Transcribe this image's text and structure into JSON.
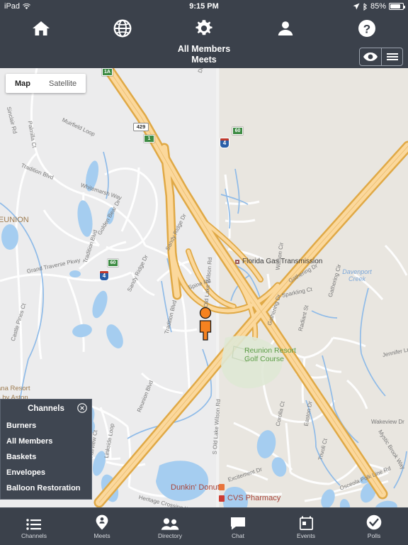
{
  "status_bar": {
    "device": "iPad",
    "wifi_icon": "wifi-icon",
    "time": "9:15 PM",
    "location_icon": "location-arrow-icon",
    "bluetooth_icon": "bluetooth-icon",
    "battery_text": "85%",
    "battery_level": 85
  },
  "header": {
    "icons": [
      {
        "name": "home-icon",
        "label": "Home"
      },
      {
        "name": "globe-icon",
        "label": "Globe"
      },
      {
        "name": "gear-icon",
        "label": "Settings"
      },
      {
        "name": "person-icon",
        "label": "Profile"
      },
      {
        "name": "help-icon",
        "label": "Help"
      }
    ],
    "title_line1": "All Members",
    "title_line2": "Meets",
    "right_buttons": [
      {
        "name": "eye-icon",
        "label": "Visibility"
      },
      {
        "name": "hamburger-icon",
        "label": "Menu"
      }
    ]
  },
  "map": {
    "type_toggle": {
      "options": [
        "Map",
        "Satellite"
      ],
      "selected": "Map"
    },
    "accent_orange": "#f58220",
    "background_left": "#ececed",
    "background_right": "#e9e6e0",
    "highway_color": "#f6c77a",
    "water_color": "#a5cdf0",
    "shields": [
      {
        "text": "1A",
        "style": "green"
      },
      {
        "text": "429",
        "style": "us"
      },
      {
        "text": "1",
        "style": "green"
      },
      {
        "text": "4",
        "style": "interstate"
      },
      {
        "text": "60",
        "style": "green"
      },
      {
        "text": "60",
        "style": "green"
      },
      {
        "text": "4",
        "style": "interstate"
      }
    ],
    "pois": [
      {
        "label": "Florida Gas Transmission",
        "kind": "industrial"
      },
      {
        "label": "Reunion Resort\nGolf Course",
        "kind": "golf"
      },
      {
        "label": "Dunkin' Donuts",
        "kind": "restaurant"
      },
      {
        "label": "CVS Pharmacy",
        "kind": "pharmacy"
      }
    ],
    "water_labels": [
      "Davenport",
      "Creek"
    ],
    "area_labels": [
      "REUNION",
      "ana Resort",
      "do by Aston"
    ],
    "road_labels": [
      "Sinclair Rd",
      "Palmilla Ct",
      "Muirfield Loop",
      "Tradition Blvd",
      "Whitemarsh Way",
      "Grand Traverse Pkwy",
      "Castle Pines Ct",
      "Golden Bear Dr",
      "Sandy Ridge Dr",
      "Sandy Ridge Dr",
      "Spine Rd",
      "Watson Cir",
      "Gathering Dr",
      "Sparkling Ct",
      "Gathering Dr",
      "Gathering Cir",
      "Radiant St",
      "Jennifer Ln",
      "Wakeview Dr",
      "Mystic Brook Way",
      "Corolla Ct",
      "Easton Dr",
      "Excitement Dr",
      "Trivoli Ct",
      "Osceola Polk Line Rd",
      "S Old Lake Wilson Rd",
      "S Old Lake Wilson Rd",
      "Tradition Blvd",
      "Reunion Blvd",
      "Linkside Loop",
      "Fairview Ct",
      "Heritage Crossing Way",
      "Dr"
    ],
    "user_marker": {
      "name": "user-location-marker",
      "color": "#f58220"
    }
  },
  "channels_panel": {
    "title": "Channels",
    "close_icon": "close-icon",
    "items": [
      "Burners",
      "All Members",
      "Baskets",
      "Envelopes",
      "Balloon Restoration"
    ]
  },
  "tab_bar": {
    "tabs": [
      {
        "label": "Channels",
        "icon": "list-icon"
      },
      {
        "label": "Meets",
        "icon": "map-pin-person-icon"
      },
      {
        "label": "Directory",
        "icon": "people-icon"
      },
      {
        "label": "Chat",
        "icon": "chat-bubble-icon"
      },
      {
        "label": "Events",
        "icon": "calendar-icon"
      },
      {
        "label": "Polls",
        "icon": "check-circle-icon"
      }
    ]
  }
}
